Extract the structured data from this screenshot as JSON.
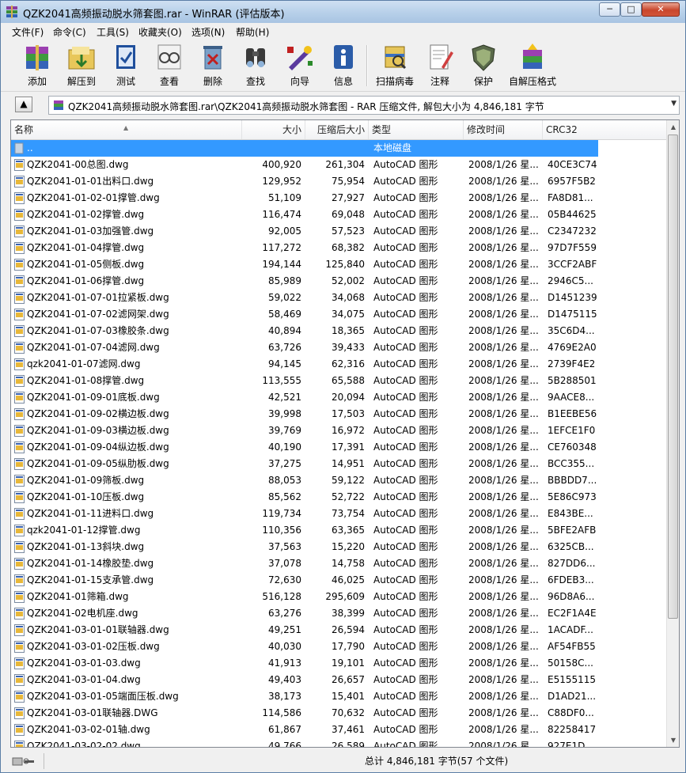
{
  "window": {
    "title": "QZK2041高频振动脱水筛套图.rar - WinRAR (评估版本)",
    "minimize_label": "─",
    "maximize_label": "□",
    "close_label": "✕"
  },
  "menu": [
    "文件(F)",
    "命令(C)",
    "工具(S)",
    "收藏夹(O)",
    "选项(N)",
    "帮助(H)"
  ],
  "toolbar": [
    {
      "label": "添加",
      "icon": "add-archive-icon"
    },
    {
      "label": "解压到",
      "icon": "extract-to-icon"
    },
    {
      "label": "测试",
      "icon": "test-icon"
    },
    {
      "label": "查看",
      "icon": "view-icon"
    },
    {
      "label": "删除",
      "icon": "delete-icon"
    },
    {
      "label": "查找",
      "icon": "find-icon"
    },
    {
      "label": "向导",
      "icon": "wizard-icon"
    },
    {
      "label": "信息",
      "icon": "info-icon"
    },
    {
      "label": "扫描病毒",
      "icon": "virus-scan-icon"
    },
    {
      "label": "注释",
      "icon": "comment-icon"
    },
    {
      "label": "保护",
      "icon": "protect-icon"
    },
    {
      "label": "自解压格式",
      "icon": "sfx-icon"
    }
  ],
  "address": {
    "up_label": "▲",
    "path": "QZK2041高频振动脱水筛套图.rar\\QZK2041高频振动脱水筛套图 - RAR 压缩文件, 解包大小为 4,846,181 字节"
  },
  "columns": {
    "name": "名称",
    "size": "大小",
    "packed": "压缩后大小",
    "type": "类型",
    "modified": "修改时间",
    "crc": "CRC32"
  },
  "parent_row": {
    "name": "..",
    "type": "本地磁盘"
  },
  "files": [
    {
      "name": "QZK2041-00总图.dwg",
      "size": "400,920",
      "packed": "261,304",
      "type": "AutoCAD 图形",
      "modified": "2008/1/26 星...",
      "crc": "40CE3C74"
    },
    {
      "name": "QZK2041-01-01出料口.dwg",
      "size": "129,952",
      "packed": "75,954",
      "type": "AutoCAD 图形",
      "modified": "2008/1/26 星...",
      "crc": "6957F5B2"
    },
    {
      "name": "QZK2041-01-02-01撑管.dwg",
      "size": "51,109",
      "packed": "27,927",
      "type": "AutoCAD 图形",
      "modified": "2008/1/26 星...",
      "crc": "FA8D81..."
    },
    {
      "name": "QZK2041-01-02撑管.dwg",
      "size": "116,474",
      "packed": "69,048",
      "type": "AutoCAD 图形",
      "modified": "2008/1/26 星...",
      "crc": "05B44625"
    },
    {
      "name": "QZK2041-01-03加强管.dwg",
      "size": "92,005",
      "packed": "57,523",
      "type": "AutoCAD 图形",
      "modified": "2008/1/26 星...",
      "crc": "C2347232"
    },
    {
      "name": "QZK2041-01-04撑管.dwg",
      "size": "117,272",
      "packed": "68,382",
      "type": "AutoCAD 图形",
      "modified": "2008/1/26 星...",
      "crc": "97D7F559"
    },
    {
      "name": "QZK2041-01-05侧板.dwg",
      "size": "194,144",
      "packed": "125,840",
      "type": "AutoCAD 图形",
      "modified": "2008/1/26 星...",
      "crc": "3CCF2ABF"
    },
    {
      "name": "QZK2041-01-06撑管.dwg",
      "size": "85,989",
      "packed": "52,002",
      "type": "AutoCAD 图形",
      "modified": "2008/1/26 星...",
      "crc": "2946C5..."
    },
    {
      "name": "QZK2041-01-07-01拉紧板.dwg",
      "size": "59,022",
      "packed": "34,068",
      "type": "AutoCAD 图形",
      "modified": "2008/1/26 星...",
      "crc": "D1451239"
    },
    {
      "name": "QZK2041-01-07-02滤网架.dwg",
      "size": "58,469",
      "packed": "34,075",
      "type": "AutoCAD 图形",
      "modified": "2008/1/26 星...",
      "crc": "D1475115"
    },
    {
      "name": "QZK2041-01-07-03橡胶条.dwg",
      "size": "40,894",
      "packed": "18,365",
      "type": "AutoCAD 图形",
      "modified": "2008/1/26 星...",
      "crc": "35C6D4..."
    },
    {
      "name": "QZK2041-01-07-04滤网.dwg",
      "size": "63,726",
      "packed": "39,433",
      "type": "AutoCAD 图形",
      "modified": "2008/1/26 星...",
      "crc": "4769E2A0"
    },
    {
      "name": "qzk2041-01-07滤网.dwg",
      "size": "94,145",
      "packed": "62,316",
      "type": "AutoCAD 图形",
      "modified": "2008/1/26 星...",
      "crc": "2739F4E2"
    },
    {
      "name": "QZK2041-01-08撑管.dwg",
      "size": "113,555",
      "packed": "65,588",
      "type": "AutoCAD 图形",
      "modified": "2008/1/26 星...",
      "crc": "5B288501"
    },
    {
      "name": "QZK2041-01-09-01底板.dwg",
      "size": "42,521",
      "packed": "20,094",
      "type": "AutoCAD 图形",
      "modified": "2008/1/26 星...",
      "crc": "9AACE8..."
    },
    {
      "name": "QZK2041-01-09-02横边板.dwg",
      "size": "39,998",
      "packed": "17,503",
      "type": "AutoCAD 图形",
      "modified": "2008/1/26 星...",
      "crc": "B1EEBE56"
    },
    {
      "name": "QZK2041-01-09-03横边板.dwg",
      "size": "39,769",
      "packed": "16,972",
      "type": "AutoCAD 图形",
      "modified": "2008/1/26 星...",
      "crc": "1EFCE1F0"
    },
    {
      "name": "QZK2041-01-09-04纵边板.dwg",
      "size": "40,190",
      "packed": "17,391",
      "type": "AutoCAD 图形",
      "modified": "2008/1/26 星...",
      "crc": "CE760348"
    },
    {
      "name": "QZK2041-01-09-05纵肋板.dwg",
      "size": "37,275",
      "packed": "14,951",
      "type": "AutoCAD 图形",
      "modified": "2008/1/26 星...",
      "crc": "BCC355..."
    },
    {
      "name": "QZK2041-01-09筛板.dwg",
      "size": "88,053",
      "packed": "59,122",
      "type": "AutoCAD 图形",
      "modified": "2008/1/26 星...",
      "crc": "BBBDD7..."
    },
    {
      "name": "QZK2041-01-10压板.dwg",
      "size": "85,562",
      "packed": "52,722",
      "type": "AutoCAD 图形",
      "modified": "2008/1/26 星...",
      "crc": "5E86C973"
    },
    {
      "name": "QZK2041-01-11进料口.dwg",
      "size": "119,734",
      "packed": "73,754",
      "type": "AutoCAD 图形",
      "modified": "2008/1/26 星...",
      "crc": "E843BE..."
    },
    {
      "name": "qzk2041-01-12撑管.dwg",
      "size": "110,356",
      "packed": "63,365",
      "type": "AutoCAD 图形",
      "modified": "2008/1/26 星...",
      "crc": "5BFE2AFB"
    },
    {
      "name": "QZK2041-01-13斜块.dwg",
      "size": "37,563",
      "packed": "15,220",
      "type": "AutoCAD 图形",
      "modified": "2008/1/26 星...",
      "crc": "6325CB..."
    },
    {
      "name": "QZK2041-01-14橡胶垫.dwg",
      "size": "37,078",
      "packed": "14,758",
      "type": "AutoCAD 图形",
      "modified": "2008/1/26 星...",
      "crc": "827DD6..."
    },
    {
      "name": "QZK2041-01-15支承管.dwg",
      "size": "72,630",
      "packed": "46,025",
      "type": "AutoCAD 图形",
      "modified": "2008/1/26 星...",
      "crc": "6FDEB3..."
    },
    {
      "name": "QZK2041-01筛箱.dwg",
      "size": "516,128",
      "packed": "295,609",
      "type": "AutoCAD 图形",
      "modified": "2008/1/26 星...",
      "crc": "96D8A6..."
    },
    {
      "name": "QZK2041-02电机座.dwg",
      "size": "63,276",
      "packed": "38,399",
      "type": "AutoCAD 图形",
      "modified": "2008/1/26 星...",
      "crc": "EC2F1A4E"
    },
    {
      "name": "QZK2041-03-01-01联轴器.dwg",
      "size": "49,251",
      "packed": "26,594",
      "type": "AutoCAD 图形",
      "modified": "2008/1/26 星...",
      "crc": "1ACADF..."
    },
    {
      "name": "QZK2041-03-01-02压板.dwg",
      "size": "40,030",
      "packed": "17,790",
      "type": "AutoCAD 图形",
      "modified": "2008/1/26 星...",
      "crc": "AF54FB55"
    },
    {
      "name": "QZK2041-03-01-03.dwg",
      "size": "41,913",
      "packed": "19,101",
      "type": "AutoCAD 图形",
      "modified": "2008/1/26 星...",
      "crc": "50158C..."
    },
    {
      "name": "QZK2041-03-01-04.dwg",
      "size": "49,403",
      "packed": "26,657",
      "type": "AutoCAD 图形",
      "modified": "2008/1/26 星...",
      "crc": "E5155115"
    },
    {
      "name": "QZK2041-03-01-05端面压板.dwg",
      "size": "38,173",
      "packed": "15,401",
      "type": "AutoCAD 图形",
      "modified": "2008/1/26 星...",
      "crc": "D1AD21..."
    },
    {
      "name": "QZK2041-03-01联轴器.DWG",
      "size": "114,586",
      "packed": "70,632",
      "type": "AutoCAD 图形",
      "modified": "2008/1/26 星...",
      "crc": "C88DF0..."
    },
    {
      "name": "QZK2041-03-02-01轴.dwg",
      "size": "61,867",
      "packed": "37,461",
      "type": "AutoCAD 图形",
      "modified": "2008/1/26 星...",
      "crc": "82258417"
    },
    {
      "name": "QZK2041-03-02-02.dwg",
      "size": "49,766",
      "packed": "26,589",
      "type": "AutoCAD 图形",
      "modified": "2008/1/26 星...",
      "crc": "927E1D..."
    }
  ],
  "status": {
    "text": "总计 4,846,181 字节(57 个文件)"
  },
  "colors": {
    "selection": "#3399ff",
    "title_bar": "#b9d1ea",
    "close_button": "#c9462c"
  }
}
